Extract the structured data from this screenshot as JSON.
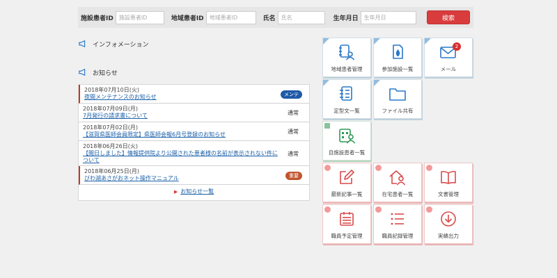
{
  "search": {
    "facility_id_label": "施設患者ID",
    "facility_id_placeholder": "施設患者ID",
    "region_id_label": "地域患者ID",
    "region_id_placeholder": "地域患者ID",
    "name_label": "氏名",
    "name_placeholder": "氏名",
    "birth_label": "生年月日",
    "birth_placeholder": "生年月日",
    "button_label": "検索"
  },
  "info_section": {
    "title": "インフォメーション"
  },
  "notice_section": {
    "title": "お知らせ"
  },
  "notices": [
    {
      "date": "2018年07月10日(火)",
      "title": "夜間メンテナンスのお知らせ",
      "badge": "メンテ",
      "badge_type": "blue",
      "highlight": true
    },
    {
      "date": "2018年07月09日(月)",
      "title": "7月発行の請求書について",
      "badge": "通常",
      "badge_type": "plain",
      "highlight": false
    },
    {
      "date": "2018年07月02日(月)",
      "title": "【滋賀県医師会員限定】県医師会報6月号登録のお知らせ",
      "badge": "通常",
      "badge_type": "plain",
      "highlight": false
    },
    {
      "date": "2018年06月26日(火)",
      "title": "【閲日しました】情報提供院より公開された患者様の名前が表示されない件について",
      "badge": "通常",
      "badge_type": "plain",
      "highlight": false
    },
    {
      "date": "2018年06月25日(月)",
      "title": "びわ湖あさがおネット操作マニュアル",
      "badge": "重要",
      "badge_type": "red",
      "highlight": true
    }
  ],
  "notice_more": "お知らせ一覧",
  "tiles": [
    {
      "label": "地域患者管理",
      "icon": "patient-list-icon",
      "style": "blue"
    },
    {
      "label": "参加施設一覧",
      "icon": "facility-icon",
      "style": "blue"
    },
    {
      "label": "メール",
      "icon": "mail-icon",
      "style": "blue",
      "badge": "2"
    },
    {
      "label": "定型文一覧",
      "icon": "document-list-icon",
      "style": "blue"
    },
    {
      "label": "ファイル共有",
      "icon": "folder-icon",
      "style": "blue"
    },
    {
      "label": "自施設患者一覧",
      "icon": "hospital-patient-icon",
      "style": "green"
    },
    {
      "label": "最新記事一覧",
      "icon": "edit-icon",
      "style": "pink"
    },
    {
      "label": "在宅患者一覧",
      "icon": "home-patient-icon",
      "style": "pink"
    },
    {
      "label": "文書管理",
      "icon": "book-icon",
      "style": "pink"
    },
    {
      "label": "職員予定管理",
      "icon": "calendar-icon",
      "style": "pink"
    },
    {
      "label": "職員記録管理",
      "icon": "list-icon",
      "style": "pink"
    },
    {
      "label": "実績出力",
      "icon": "download-icon",
      "style": "pink"
    }
  ],
  "colors": {
    "accent_red": "#d83c3c",
    "tile_blue": "#2a78c8",
    "tile_green": "#2f9a53",
    "tile_pink": "#d94a4a",
    "link": "#1a5fa8"
  }
}
